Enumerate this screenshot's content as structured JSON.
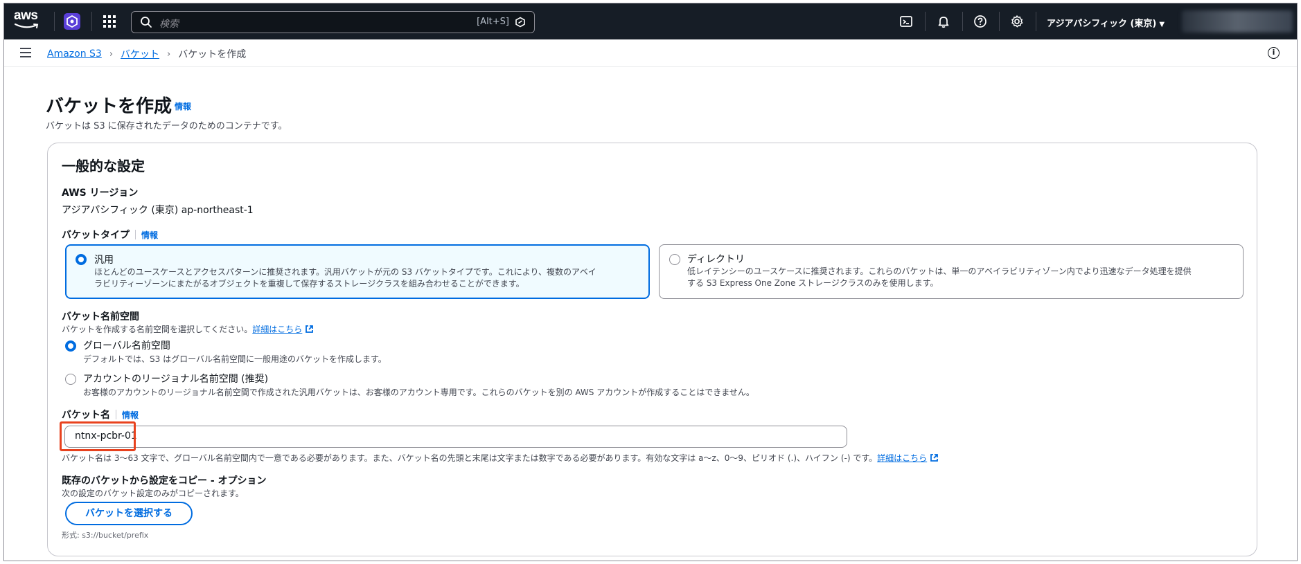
{
  "nav": {
    "logo_text": "aws",
    "search_placeholder": "検索",
    "search_shortcut": "[Alt+S]",
    "region": "アジアパシフィック (東京)",
    "region_caret": "▼",
    "icons": [
      "cloudshell-icon",
      "bell-icon",
      "help-icon",
      "gear-icon"
    ]
  },
  "breadcrumb": {
    "items": [
      "Amazon S3",
      "バケット"
    ],
    "separator": "›",
    "current": "バケットを作成",
    "info_glyph": "i"
  },
  "header": {
    "title": "バケットを作成",
    "info": "情報",
    "description": "バケットは S3 に保存されたデータのためのコンテナです。"
  },
  "general": {
    "title": "一般的な設定",
    "region_label": "AWS リージョン",
    "region_value": "アジアパシフィック (東京) ap-northeast-1",
    "bucket_type": {
      "label": "バケットタイプ",
      "info": "情報",
      "options": [
        {
          "title": "汎用",
          "description": "ほとんどのユースケースとアクセスパターンに推奨されます。汎用バケットが元の S3 バケットタイプです。これにより、複数のアベイ\nラビリティーゾーンにまたがるオブジェクトを重複して保存するストレージクラスを組み合わせることができます。",
          "selected": true
        },
        {
          "title": "ディレクトリ",
          "description": "低レイテンシーのユースケースに推奨されます。これらのバケットは、単一のアベイラビリティゾーン内でより迅速なデータ処理を提供\nする S3 Express One Zone ストレージクラスのみを使用します。",
          "selected": false
        }
      ]
    },
    "namespace": {
      "label": "バケット名前空間",
      "description": "バケットを作成する名前空間を選択してください。",
      "link": "詳細はこちら",
      "options": [
        {
          "title": "グローバル名前空間",
          "description": "デフォルトでは、S3 はグローバル名前空間に一般用途のバケットを作成します。",
          "selected": true
        },
        {
          "title": "アカウントのリージョナル名前空間 (推奨)",
          "description": "お客様のアカウントのリージョナル名前空間で作成された汎用バケットは、お客様のアカウント専用です。これらのバケットを別の AWS アカウントが作成することはできません。",
          "selected": false
        }
      ]
    },
    "bucket_name": {
      "label": "バケット名",
      "info": "情報",
      "value": "ntnx-pcbr-01",
      "hint": "バケット名は 3〜63 文字で、グローバル名前空間内で一意である必要があります。また、バケット名の先頭と末尾は文字または数字である必要があります。有効な文字は a〜z、0〜9、ピリオド (.)、ハイフン (-) です。",
      "link": "詳細はこちら"
    },
    "copy_settings": {
      "label": "既存のバケットから設定をコピー - オプション",
      "description": "次の設定のバケット設定のみがコピーされます。",
      "button": "バケットを選択する",
      "format": "形式: s3://bucket/prefix"
    }
  },
  "colors": {
    "nav_bg": "#161d26",
    "accent": "#006ce0",
    "highlight": "#e8421e"
  }
}
